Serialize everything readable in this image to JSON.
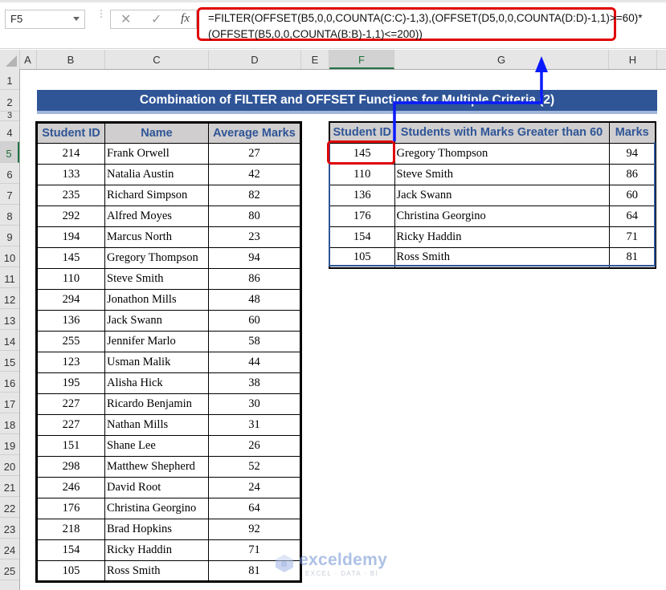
{
  "formula_bar": {
    "name_box": "F5",
    "cancel_icon": "close-icon",
    "enter_icon": "check-icon",
    "fx_label": "fx",
    "formula_line1": "=FILTER(OFFSET(B5,0,0,COUNTA(C:C)-1,3),(OFFSET(D5,0,0,COUNTA(D:D)-1,1)>=60)*",
    "formula_line2": "(OFFSET(B5,0,0,COUNTA(B:B)-1,1)<=200))"
  },
  "columns": [
    "A",
    "B",
    "C",
    "D",
    "E",
    "F",
    "G",
    "H"
  ],
  "selected_column": "F",
  "rows": [
    "1",
    "2",
    "3",
    "4",
    "5",
    "6",
    "7",
    "8",
    "9",
    "10",
    "11",
    "12",
    "13",
    "14",
    "15",
    "16",
    "17",
    "18",
    "19",
    "20",
    "21",
    "22",
    "23",
    "24",
    "25"
  ],
  "selected_row": "5",
  "title": "Combination of FILTER and OFFSET Functions for Multiple Criteria (2)",
  "main_table": {
    "headers": [
      "Student ID",
      "Name",
      "Average Marks"
    ],
    "rows": [
      [
        "214",
        "Frank Orwell",
        "27"
      ],
      [
        "133",
        "Natalia Austin",
        "42"
      ],
      [
        "235",
        "Richard Simpson",
        "82"
      ],
      [
        "292",
        "Alfred Moyes",
        "80"
      ],
      [
        "194",
        "Marcus North",
        "23"
      ],
      [
        "145",
        "Gregory Thompson",
        "94"
      ],
      [
        "110",
        "Steve Smith",
        "86"
      ],
      [
        "294",
        "Jonathon Mills",
        "48"
      ],
      [
        "136",
        "Jack Swann",
        "60"
      ],
      [
        "255",
        "Jennifer Marlo",
        "58"
      ],
      [
        "123",
        "Usman Malik",
        "44"
      ],
      [
        "195",
        "Alisha Hick",
        "38"
      ],
      [
        "227",
        "Ricardo Benjamin",
        "30"
      ],
      [
        "227",
        "Nathan Mills",
        "31"
      ],
      [
        "151",
        "Shane Lee",
        "26"
      ],
      [
        "298",
        "Matthew Shepherd",
        "52"
      ],
      [
        "246",
        "David Root",
        "24"
      ],
      [
        "176",
        "Christina Georgino",
        "64"
      ],
      [
        "218",
        "Brad Hopkins",
        "92"
      ],
      [
        "154",
        "Ricky Haddin",
        "71"
      ],
      [
        "105",
        "Ross Smith",
        "81"
      ]
    ]
  },
  "result_table": {
    "headers": [
      "Student ID",
      "Students with Marks Greater than 60",
      "Marks"
    ],
    "rows": [
      [
        "145",
        "Gregory Thompson",
        "94"
      ],
      [
        "110",
        "Steve Smith",
        "86"
      ],
      [
        "136",
        "Jack Swann",
        "60"
      ],
      [
        "176",
        "Christina Georgino",
        "64"
      ],
      [
        "154",
        "Ricky Haddin",
        "71"
      ],
      [
        "105",
        "Ross Smith",
        "81"
      ]
    ]
  },
  "watermark": {
    "brand": "exceldemy",
    "tagline": "EXCEL · DATA · BI"
  },
  "colors": {
    "title_bg": "#2f5597",
    "header_bg": "#d0cece",
    "header_text": "#2f5597",
    "highlight": "#e00000",
    "arrow": "#0000ff",
    "selection": "#217346"
  }
}
